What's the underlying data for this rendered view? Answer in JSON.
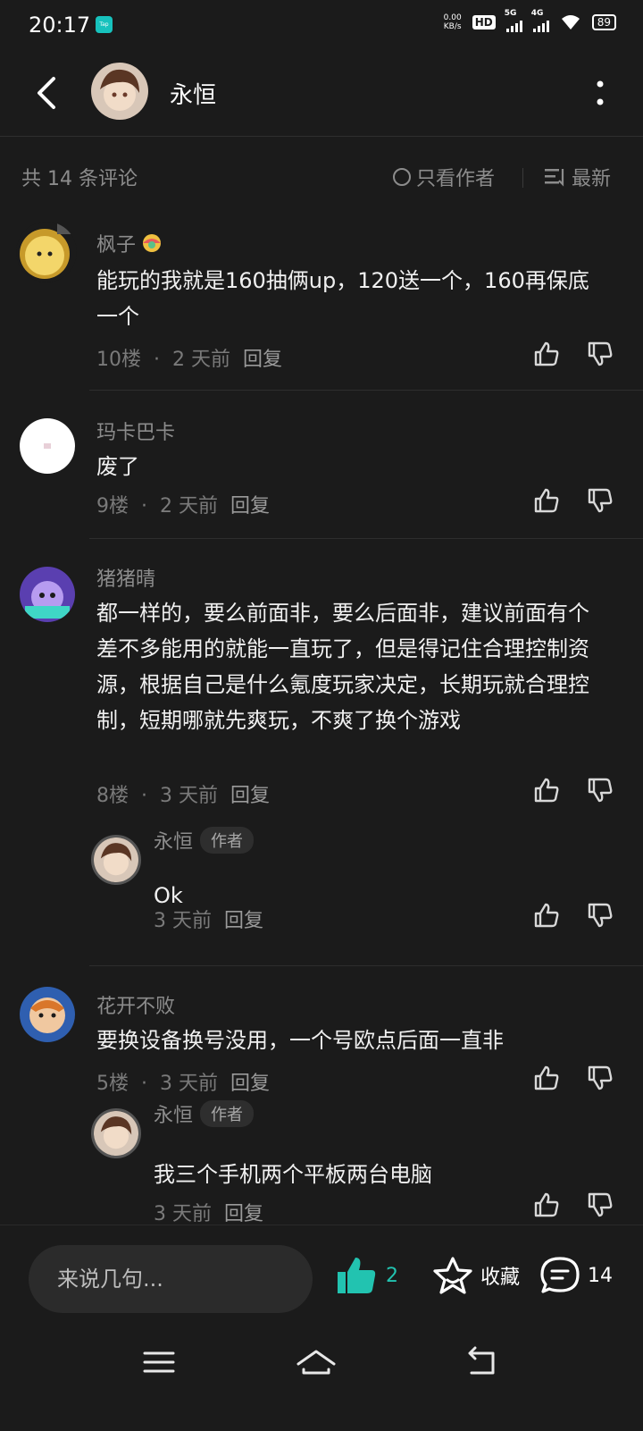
{
  "status_bar": {
    "time": "20:17",
    "app_badge": "Tap",
    "net_speed_value": "0.00",
    "net_speed_unit": "KB/s",
    "hd_label": "HD",
    "sim1_net": "5G",
    "sim2_net": "4G",
    "battery": "89"
  },
  "header": {
    "title": "永恒",
    "back_icon": "chevron-left-icon",
    "more_icon": "more-vertical-icon"
  },
  "subbar": {
    "count_label": "共 14 条评论",
    "author_only_label": "只看作者",
    "sort_label": "最新"
  },
  "comments": [
    {
      "name": "枫子",
      "text": "能玩的我就是160抽俩up，120送一个，160再保底一个",
      "floor": "10楼",
      "time": "2 天前",
      "reply": "回复",
      "avatar_color": "#e6c74a"
    },
    {
      "name": "玛卡巴卡",
      "text": "废了",
      "floor": "9楼",
      "time": "2 天前",
      "reply": "回复",
      "avatar_color": "#ffffff"
    },
    {
      "name": "猪猪晴",
      "text": "都一样的，要么前面非，要么后面非，建议前面有个差不多能用的就能一直玩了，但是得记住合理控制资源，根据自己是什么氪度玩家决定，长期玩就合理控制，短期哪就先爽玩，不爽了换个游戏",
      "floor": "8楼",
      "time": "3 天前",
      "reply": "回复",
      "avatar_color": "#7b5cd6",
      "author_reply": {
        "name": "永恒",
        "tag": "作者",
        "text": "Ok",
        "time": "3 天前",
        "reply": "回复"
      }
    },
    {
      "name": "花开不败",
      "text": "要换设备换号没用，一个号欧点后面一直非",
      "floor": "5楼",
      "time": "3 天前",
      "reply": "回复",
      "avatar_color": "#2f5fb0",
      "author_reply": {
        "name": "永恒",
        "tag": "作者",
        "text": "我三个手机两个平板两台电脑",
        "time": "3 天前",
        "reply": "回复"
      }
    }
  ],
  "bottom_bar": {
    "input_placeholder": "来说几句...",
    "like_count": "2",
    "favorite_label": "收藏",
    "comment_count": "14",
    "accent_color": "#22c3b0"
  },
  "nav_bar": {
    "icons": [
      "menu-icon",
      "home-icon",
      "back-icon"
    ]
  }
}
